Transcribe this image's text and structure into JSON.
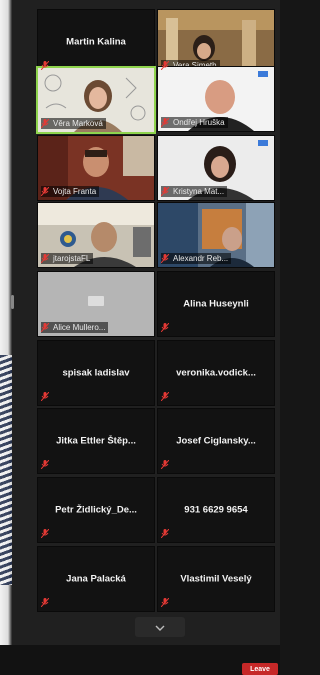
{
  "participants": [
    {
      "name": "Martin Kalina",
      "label": ""
    },
    {
      "name": "",
      "label": "Vera Simeth"
    },
    {
      "name": "",
      "label": "Věra Marková"
    },
    {
      "name": "",
      "label": "Ondřej Hruška"
    },
    {
      "name": "",
      "label": "Vojta Franta"
    },
    {
      "name": "",
      "label": "Kristyna Mat..."
    },
    {
      "name": "",
      "label": "jtarojstaFL"
    },
    {
      "name": "",
      "label": "Alexandr Reb..."
    },
    {
      "name": "",
      "label": "Alice Mullerо..."
    },
    {
      "name": "Alina Huseynli",
      "label": ""
    },
    {
      "name": "spisak ladislav",
      "label": ""
    },
    {
      "name": "veronika.vodick...",
      "label": ""
    },
    {
      "name": "Jitka Ettler Štěp...",
      "label": ""
    },
    {
      "name": "Josef Ciglansky...",
      "label": ""
    },
    {
      "name": "Petr Židlický_De...",
      "label": ""
    },
    {
      "name": "931 6629 9654",
      "label": ""
    },
    {
      "name": "Jana Palacká",
      "label": ""
    },
    {
      "name": "Vlastimil Veselý",
      "label": ""
    }
  ],
  "controls": {
    "leave_label": "Leave"
  },
  "colors": {
    "active_speaker": "#8fd44d",
    "muted_mic": "#e53935",
    "leave": "#c62828"
  }
}
